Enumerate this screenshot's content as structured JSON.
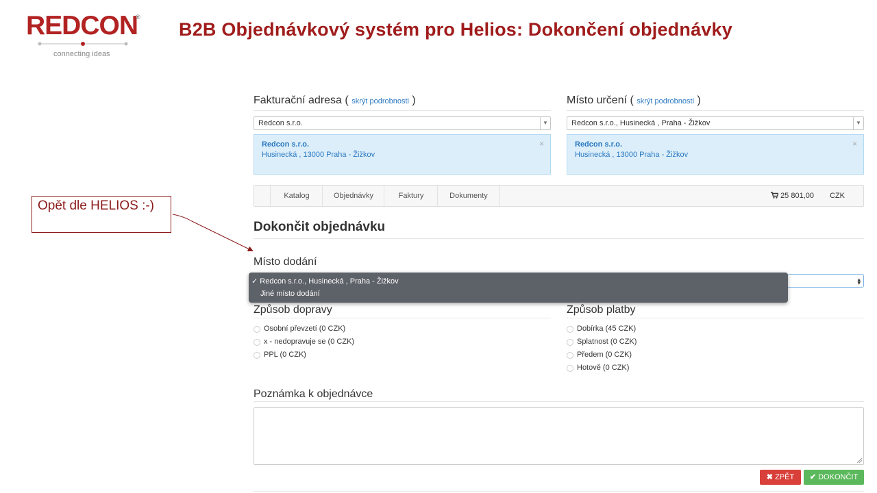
{
  "logo": {
    "text": "REDCON",
    "reg": "®",
    "tagline": "connecting ideas"
  },
  "slide_title": "B2B Objednávkový systém pro Helios: Dokončení objednávky",
  "callout": {
    "text": "Opět dle HELIOS :-)"
  },
  "billing": {
    "heading": "Fakturační adresa (",
    "link": "skrýt podrobnosti",
    "close_paren": ")",
    "select_value": "Redcon s.r.o.",
    "info_name": "Redcon s.r.o.",
    "info_address": "Husinecká , 13000 Praha - Žižkov",
    "close_glyph": "×"
  },
  "destination": {
    "heading": "Místo určení (",
    "link": "skrýt podrobnosti",
    "close_paren": ")",
    "select_value": "Redcon s.r.o., Husinecká , Praha - Žižkov",
    "info_name": "Redcon s.r.o.",
    "info_address": "Husinecká , 13000 Praha - Žižkov",
    "close_glyph": "×"
  },
  "nav": {
    "items": [
      "Katalog",
      "Objednávky",
      "Faktury",
      "Dokumenty"
    ],
    "cart_amount": "25 801,00",
    "currency": "CZK"
  },
  "main_heading": "Dokončit objednávku",
  "delivery": {
    "heading": "Místo dodání",
    "options": [
      "Redcon s.r.o., Husinecká , Praha - Žižkov",
      "Jiné místo dodání"
    ],
    "check_glyph": "✓",
    "selected_index": 0
  },
  "shipping": {
    "heading": "Způsob dopravy",
    "options": [
      "Osobní převzetí (0  CZK)",
      "x - nedopravuje se (0  CZK)",
      "PPL (0  CZK)"
    ]
  },
  "payment": {
    "heading": "Způsob platby",
    "options": [
      "Dobírka (45  CZK)",
      "Splatnost (0  CZK)",
      "Předem (0  CZK)",
      "Hotově (0  CZK)"
    ]
  },
  "note": {
    "heading": "Poznámka k objednávce",
    "value": ""
  },
  "buttons": {
    "back": "ZPĚT",
    "finish": "DOKONČIT",
    "back_color": "#d9403a",
    "finish_color": "#5cb85c"
  }
}
